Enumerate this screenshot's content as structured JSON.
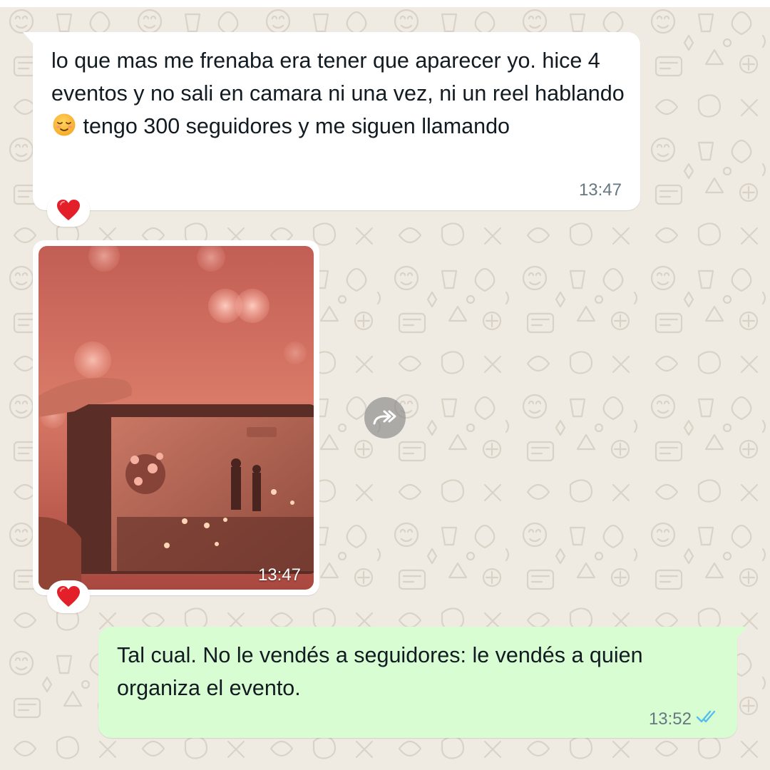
{
  "theme": {
    "wallpaper_color": "#efeae2",
    "incoming_bubble_color": "#ffffff",
    "outgoing_bubble_color": "#d9fdd3",
    "read_tick_color": "#53bdeb"
  },
  "messages": [
    {
      "direction": "incoming",
      "type": "text",
      "text_before_emoji": "lo que mas me frenaba era tener que aparecer yo. hice 4 eventos y no sali en camara ni una vez, ni un reel hablando",
      "emoji": "relieved-face",
      "text_after_emoji": " tengo 300 seguidores y me siguen llamando",
      "time": "13:47",
      "reaction": "red-heart"
    },
    {
      "direction": "incoming",
      "type": "image",
      "image_subject": "phone screen filming an event venue with pink bokeh lights",
      "time": "13:47",
      "reaction": "red-heart"
    },
    {
      "direction": "outgoing",
      "type": "text",
      "text": "Tal cual. No le vendés a seguidores: le vendés a quien organiza el evento.",
      "time": "13:52",
      "status": "read"
    }
  ],
  "forward_button": {
    "icon": "forward-icon"
  }
}
